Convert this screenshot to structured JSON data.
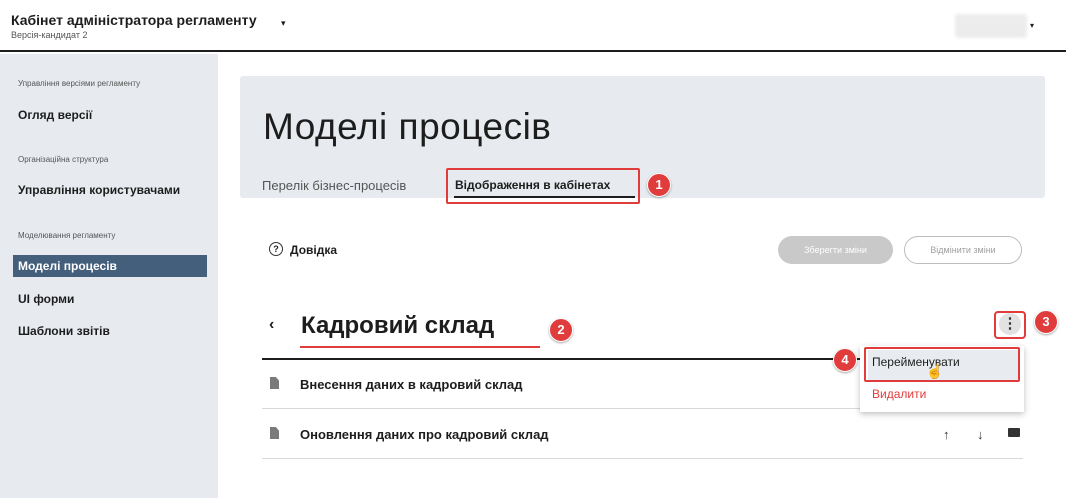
{
  "app": {
    "title": "Кабінет адміністратора регламенту",
    "subtitle": "Версія-кандидат 2",
    "title_caret": "▾",
    "user_caret": "▾"
  },
  "sidebar": {
    "groups": [
      {
        "label": "Управління версіями регламенту",
        "items": [
          "Огляд версії"
        ]
      },
      {
        "label": "Організаційна структура",
        "items": [
          "Управління користувачами"
        ]
      },
      {
        "label": "Моделювання регламенту",
        "items": [
          "Моделі процесів",
          "UI форми",
          "Шаблони звітів"
        ]
      }
    ],
    "active_item": "Моделі процесів"
  },
  "page": {
    "title": "Моделі процесів",
    "tabs": [
      {
        "label": "Перелік бізнес-процесів",
        "active": false
      },
      {
        "label": "Відображення в кабінетах",
        "active": true
      }
    ]
  },
  "toolbar": {
    "help_icon": "?",
    "help_label": "Довідка",
    "save_label": "Зберегти зміни",
    "cancel_label": "Відмінити зміни"
  },
  "section": {
    "back_icon": "‹",
    "title": "Кадровий склад",
    "kebab_icon": "⋮",
    "menu": {
      "rename_label": "Перейменувати",
      "delete_label": "Видалити"
    },
    "rows": [
      {
        "label": "Внесення даних в кадровий склад"
      },
      {
        "label": "Оновлення даних про кадровий склад",
        "actions": {
          "up": "↑",
          "down": "↓"
        }
      }
    ]
  },
  "annotations": {
    "badge1": "1",
    "badge2": "2",
    "badge3": "3",
    "badge4": "4",
    "highlight_color": "#e03c3c"
  },
  "colors": {
    "accent": "#435f7c",
    "panel_bg": "#e7ebf0",
    "danger": "#e03c3c"
  }
}
